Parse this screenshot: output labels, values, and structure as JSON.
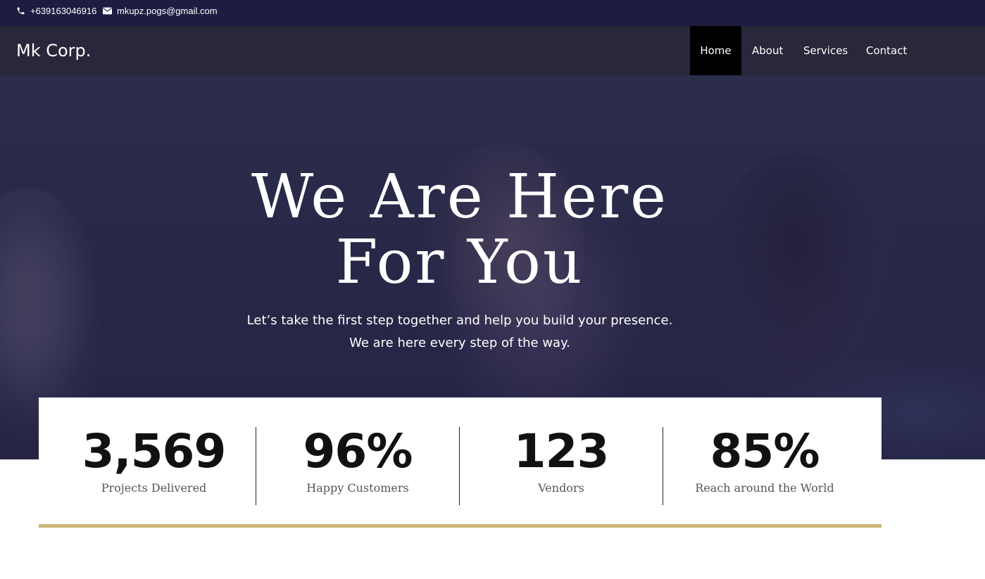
{
  "topbar": {
    "phone": "+639163046916",
    "email": "mkupz.pogs@gmail.com",
    "icons": [
      "phone-icon",
      "envelope-icon"
    ]
  },
  "navbar": {
    "logo": "Mk Corp.",
    "links": [
      {
        "label": "Home",
        "active": true
      },
      {
        "label": "About",
        "active": false
      },
      {
        "label": "Services",
        "active": false
      },
      {
        "label": "Contact",
        "active": false
      }
    ]
  },
  "hero": {
    "title_line1": "We Are Here",
    "title_line2": "For You",
    "subtitle_line1": "Let’s take the first step together and help you build your presence.",
    "subtitle_line2": "We are here every step of the way."
  },
  "stats": [
    {
      "value": "3,569",
      "label": "Projects Delivered"
    },
    {
      "value": "96%",
      "label": "Happy Customers"
    },
    {
      "value": "123",
      "label": "Vendors"
    },
    {
      "value": "85%",
      "label": "Reach around the World"
    }
  ],
  "colors": {
    "topbar_bg": "#1d1c41",
    "navbar_bg": "#28273b",
    "active_nav_bg": "#000000",
    "accent_bar": "#cdb676"
  }
}
